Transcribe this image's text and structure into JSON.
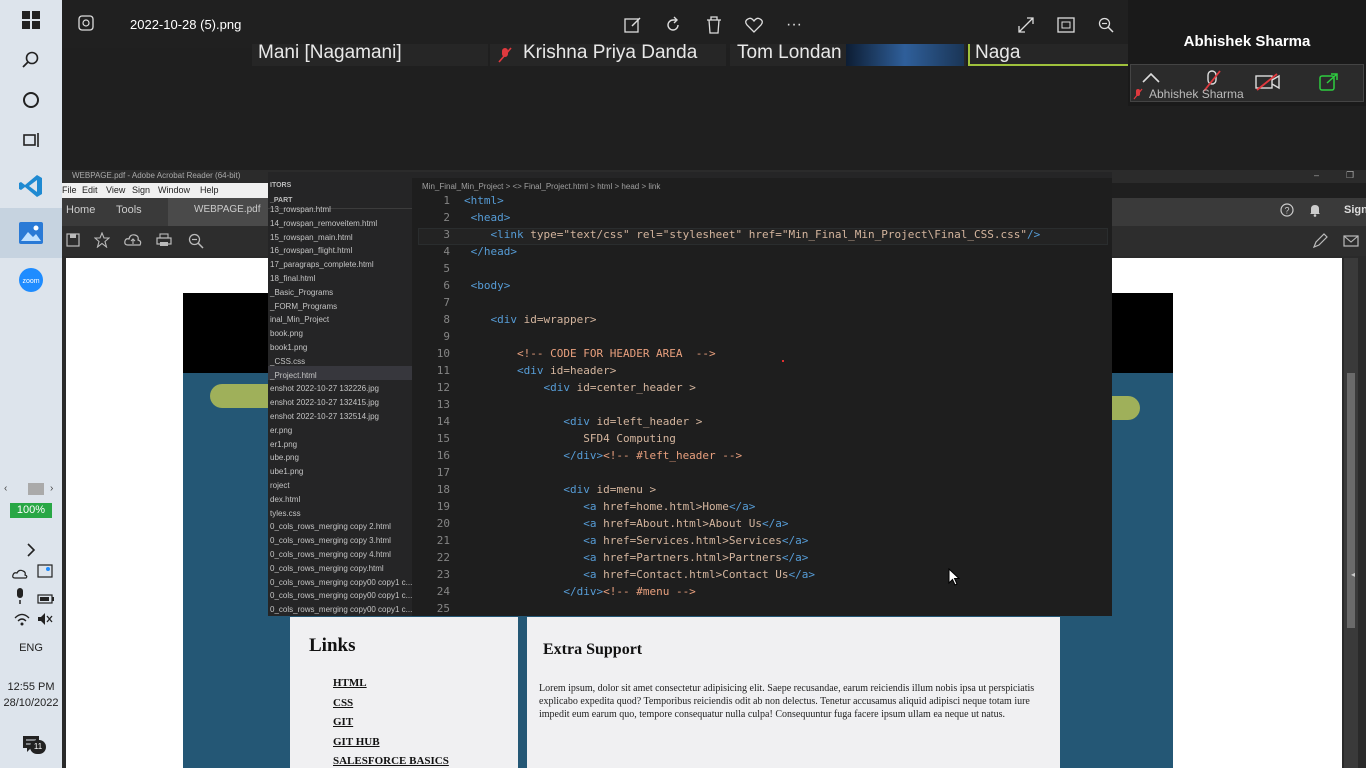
{
  "taskbar": {
    "zoom_percent": "100%",
    "language": "ENG",
    "time": "12:55 PM",
    "date": "28/10/2022",
    "notification_count": "11"
  },
  "viewer": {
    "filename": "2022-10-28 (5).png"
  },
  "participants": [
    "Mani [Nagamani]",
    "Krishna Priya Danda",
    "Tom Londan",
    "Naga"
  ],
  "speaker": {
    "name": "Abhishek Sharma",
    "label": "Abhishek Sharma"
  },
  "acrobat": {
    "title": "WEBPAGE.pdf - Adobe Acrobat Reader (64-bit)",
    "menu": [
      "File",
      "Edit",
      "View",
      "Sign",
      "Window",
      "Help"
    ],
    "tabs": [
      "Home",
      "Tools",
      "WEBPAGE.pdf"
    ],
    "sign_label": "Sign"
  },
  "vscode": {
    "explorer_header": "ITORS",
    "folder": "_PART",
    "files": [
      "13_rowspan.html",
      "14_rowspan_removeitem.html",
      "15_rowspan_main.html",
      "16_rowspan_flight.html",
      "17_paragraps_complete.html",
      "18_final.html",
      "_Basic_Programs",
      "_FORM_Programs",
      "inal_Min_Project",
      "book.png",
      "book1.png",
      "_CSS.css",
      "_Project.html",
      "enshot 2022-10-27 132226.jpg",
      "enshot 2022-10-27 132415.jpg",
      "enshot 2022-10-27 132514.jpg",
      "er.png",
      "er1.png",
      "ube.png",
      "ube1.png",
      "roject",
      "dex.html",
      "tyles.css",
      "0_cols_rows_merging copy 2.html",
      "0_cols_rows_merging copy 3.html",
      "0_cols_rows_merging copy 4.html",
      "0_cols_rows_merging copy.html",
      "0_cols_rows_merging copy00 copy1 c...",
      "0_cols_rows_merging copy00 copy1 c...",
      "0_cols_rows_merging copy00 copy1 c..."
    ],
    "breadcrumbs": "Min_Final_Min_Project > <> Final_Project.html > html > head > link",
    "lines": [
      {
        "n": "1",
        "indent": "",
        "parts": [
          [
            "tag",
            "<html>"
          ]
        ]
      },
      {
        "n": "2",
        "indent": " ",
        "parts": [
          [
            "tag",
            "<head>"
          ]
        ]
      },
      {
        "n": "3",
        "indent": "    ",
        "parts": [
          [
            "tag",
            "<link "
          ],
          [
            "txt",
            "type=\"text/css\" rel=\"stylesheet\" href=\"Min_Final_Min_Project\\Final_CSS.css\""
          ],
          [
            "tag",
            "/>"
          ]
        ]
      },
      {
        "n": "4",
        "indent": " ",
        "parts": [
          [
            "tag",
            "</head>"
          ]
        ]
      },
      {
        "n": "5",
        "indent": "",
        "parts": []
      },
      {
        "n": "6",
        "indent": " ",
        "parts": [
          [
            "tag",
            "<body>"
          ]
        ]
      },
      {
        "n": "7",
        "indent": "",
        "parts": []
      },
      {
        "n": "8",
        "indent": "    ",
        "parts": [
          [
            "tag",
            "<div "
          ],
          [
            "txt",
            "id=wrapper>"
          ]
        ]
      },
      {
        "n": "9",
        "indent": "",
        "parts": []
      },
      {
        "n": "10",
        "indent": "        ",
        "parts": [
          [
            "com",
            "<!-- CODE FOR HEADER AREA  -->"
          ]
        ]
      },
      {
        "n": "11",
        "indent": "        ",
        "parts": [
          [
            "tag",
            "<div "
          ],
          [
            "txt",
            "id=header>"
          ]
        ]
      },
      {
        "n": "12",
        "indent": "            ",
        "parts": [
          [
            "tag",
            "<div "
          ],
          [
            "txt",
            "id=center_header >"
          ]
        ]
      },
      {
        "n": "13",
        "indent": "",
        "parts": []
      },
      {
        "n": "14",
        "indent": "               ",
        "parts": [
          [
            "tag",
            "<div "
          ],
          [
            "txt",
            "id=left_header >"
          ]
        ]
      },
      {
        "n": "15",
        "indent": "                  ",
        "parts": [
          [
            "txt",
            "SFD4 Computing"
          ]
        ]
      },
      {
        "n": "16",
        "indent": "               ",
        "parts": [
          [
            "tag",
            "</div>"
          ],
          [
            "com",
            "<!-- #left_header -->"
          ]
        ]
      },
      {
        "n": "17",
        "indent": "",
        "parts": []
      },
      {
        "n": "18",
        "indent": "               ",
        "parts": [
          [
            "tag",
            "<div "
          ],
          [
            "txt",
            "id=menu >"
          ]
        ]
      },
      {
        "n": "19",
        "indent": "                  ",
        "parts": [
          [
            "tag",
            "<a "
          ],
          [
            "txt",
            "href=home.html>Home"
          ],
          [
            "tag",
            "</a>"
          ]
        ]
      },
      {
        "n": "20",
        "indent": "                  ",
        "parts": [
          [
            "tag",
            "<a "
          ],
          [
            "txt",
            "href=About.html>About Us"
          ],
          [
            "tag",
            "</a>"
          ]
        ]
      },
      {
        "n": "21",
        "indent": "                  ",
        "parts": [
          [
            "tag",
            "<a "
          ],
          [
            "txt",
            "href=Services.html>Services"
          ],
          [
            "tag",
            "</a>"
          ]
        ]
      },
      {
        "n": "22",
        "indent": "                  ",
        "parts": [
          [
            "tag",
            "<a "
          ],
          [
            "txt",
            "href=Partners.html>Partners"
          ],
          [
            "tag",
            "</a>"
          ]
        ]
      },
      {
        "n": "23",
        "indent": "                  ",
        "parts": [
          [
            "tag",
            "<a "
          ],
          [
            "txt",
            "href=Contact.html>Contact Us"
          ],
          [
            "tag",
            "</a>"
          ]
        ]
      },
      {
        "n": "24",
        "indent": "               ",
        "parts": [
          [
            "tag",
            "</div>"
          ],
          [
            "com",
            "<!-- #menu -->"
          ]
        ]
      },
      {
        "n": "25",
        "indent": "",
        "parts": []
      }
    ]
  },
  "webpage": {
    "links_title": "Links",
    "links": [
      "HTML",
      "CSS",
      "GIT",
      "GIT HUB",
      "SALESFORCE BASICS"
    ],
    "extra_title": "Extra Support",
    "extra_text": "Lorem ipsum, dolor sit amet consectetur adipisicing elit. Saepe recusandae, earum reiciendis illum nobis ipsa ut perspiciatis explicabo expedita quod? Temporibus reiciendis odit ab non delectus. Tenetur accusamus aliquid adipisci neque totam iure impedit eum earum quo, tempore consequatur nulla culpa! Consequuntur fuga facere ipsum ullam ea neque ut natus."
  },
  "colors": {
    "page_blue": "#245775",
    "blob": "#9fb05a",
    "vscode_bg": "#1e1e1e",
    "zoom_blue": "#1e8cff"
  }
}
